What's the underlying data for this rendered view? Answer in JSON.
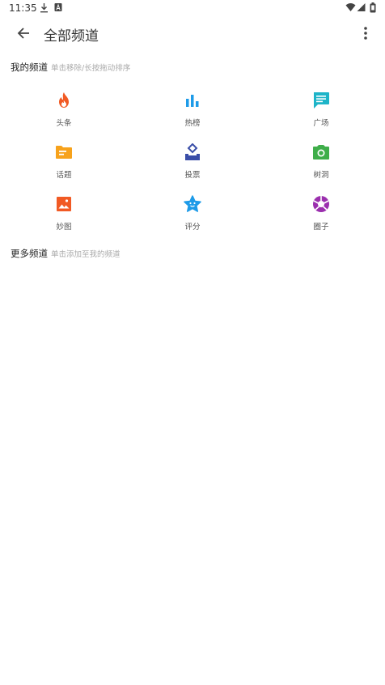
{
  "status_bar": {
    "time": "11:35",
    "icons": [
      "download-icon",
      "a-box-icon",
      "wifi-icon",
      "signal-icon",
      "battery-icon"
    ]
  },
  "app_bar": {
    "back_icon": "arrow-left-icon",
    "title": "全部频道",
    "menu_icon": "more-vert-icon"
  },
  "my_channels": {
    "title": "我的频道",
    "hint": "单击移除/长按拖动排序",
    "items": [
      {
        "label": "头条",
        "icon": "flame-icon",
        "color": "#f15a24"
      },
      {
        "label": "热榜",
        "icon": "bar-chart-icon",
        "color": "#1e9be8"
      },
      {
        "label": "广场",
        "icon": "chat-icon",
        "color": "#1eb4c8"
      },
      {
        "label": "话题",
        "icon": "folder-icon",
        "color": "#f7a21b"
      },
      {
        "label": "投票",
        "icon": "vote-icon",
        "color": "#3a4ea8"
      },
      {
        "label": "树洞",
        "icon": "camera-icon",
        "color": "#3fae4a"
      },
      {
        "label": "妙图",
        "icon": "image-icon",
        "color": "#f15a24"
      },
      {
        "label": "评分",
        "icon": "star-face-icon",
        "color": "#1e9be8"
      },
      {
        "label": "圈子",
        "icon": "aperture-icon",
        "color": "#9b2fae"
      }
    ]
  },
  "more_channels": {
    "title": "更多频道",
    "hint": "单击添加至我的频道"
  }
}
